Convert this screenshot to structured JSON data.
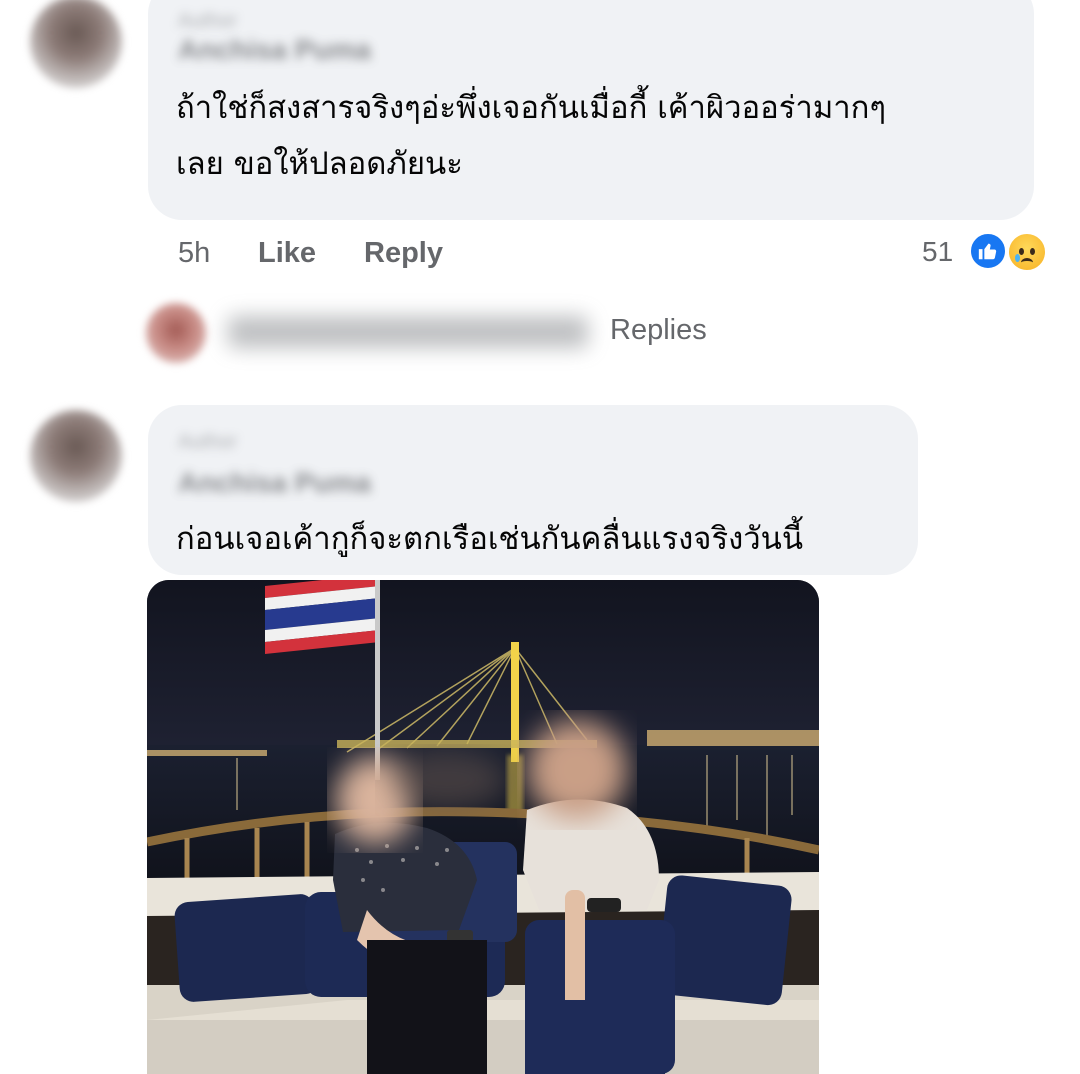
{
  "comments": [
    {
      "author_name": "Anchisa Puma",
      "sub_label": "Author",
      "text_line1": "ถ้าใช่ก็สงสารจริงๆอ่ะพึ่งเจอกันเมื่อกี้ เค้าผิวออร่ามากๆ",
      "text_line2": "เลย ขอให้ปลอดภัยนะ",
      "time": "5h",
      "like_label": "Like",
      "reply_label": "Reply",
      "reaction_count": "51",
      "reactions": [
        "like-icon",
        "sad-icon"
      ]
    },
    {
      "author_name": "Anchisa Puma",
      "sub_label": "Author",
      "text_line1": "ก่อนเจอเค้ากูก็จะตกเรือเช่นกันคลื่นแรงจริงวันนี้"
    }
  ],
  "replies_summary": {
    "label": "Replies"
  },
  "colors": {
    "bubble": "#f0f2f5",
    "meta_text": "#65676b",
    "like_blue": "#1877f2"
  }
}
